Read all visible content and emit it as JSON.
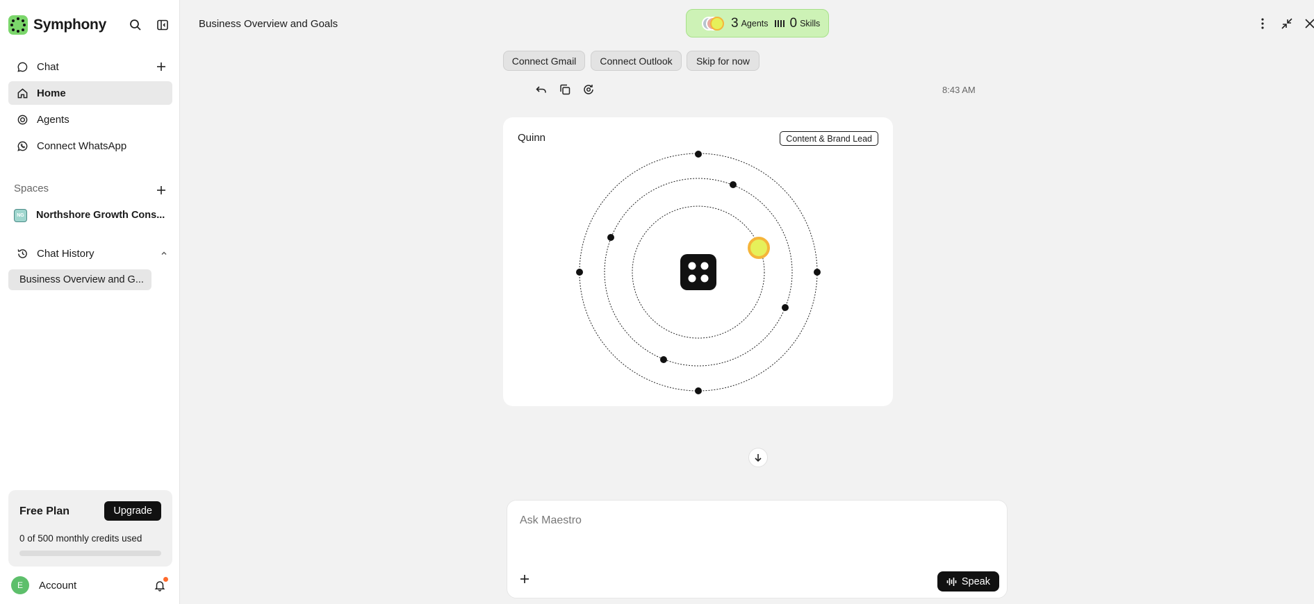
{
  "app": {
    "name": "Symphony"
  },
  "sidebar": {
    "nav": [
      {
        "label": "Chat",
        "icon": "chat-bubble-icon"
      },
      {
        "label": "Home",
        "icon": "home-icon",
        "active": true
      },
      {
        "label": "Agents",
        "icon": "target-icon"
      },
      {
        "label": "Connect WhatsApp",
        "icon": "whatsapp-icon"
      }
    ],
    "spaces_label": "Spaces",
    "space": {
      "name": "Northshore Growth Cons...",
      "badge": "NG"
    },
    "chat_history_label": "Chat History",
    "history_items": [
      "Business Overview and G..."
    ],
    "plan": {
      "title": "Free Plan",
      "upgrade_label": "Upgrade",
      "credits_text": "0 of 500 monthly credits used",
      "credits_used_fraction": 0
    },
    "account": {
      "label": "Account",
      "initial": "E",
      "has_notification": true
    }
  },
  "header": {
    "chat_title": "Business Overview and Goals",
    "agents_count": "3",
    "agents_label": "Agents",
    "skills_count": "0",
    "skills_label": "Skills"
  },
  "quick_actions": [
    "Connect Gmail",
    "Connect Outlook",
    "Skip for now"
  ],
  "message": {
    "timestamp": "8:43 AM"
  },
  "agent_card": {
    "name": "Quinn",
    "role": "Content & Brand Lead"
  },
  "composer": {
    "placeholder": "Ask Maestro",
    "speak_label": "Speak"
  },
  "colors": {
    "brand_green": "#7bd66b",
    "pill_bg": "#cdf2b6",
    "active_orb": "#e6f05a",
    "orb_ring": "#f5b53a",
    "notification": "#ff6a2b"
  }
}
